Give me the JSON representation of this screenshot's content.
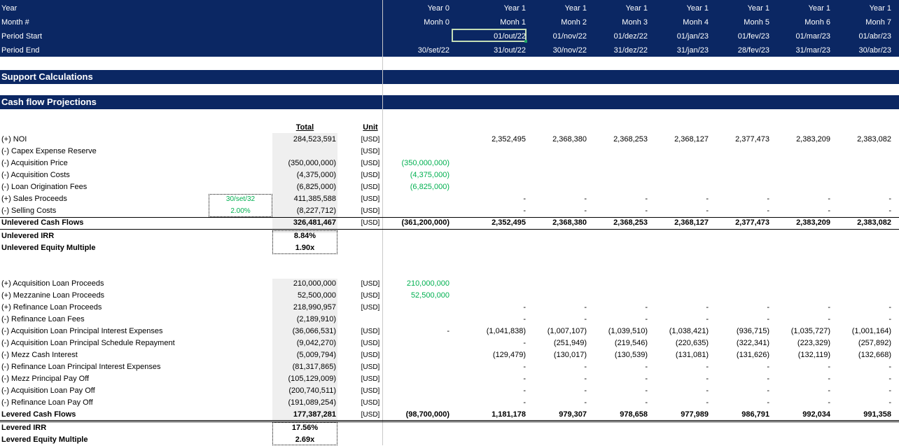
{
  "header": {
    "labels": [
      "Year",
      "Month #",
      "Period Start",
      "Period End"
    ],
    "columns": [
      {
        "year": "Year 0",
        "month": "Monh 0",
        "start": "",
        "end": "30/set/22"
      },
      {
        "year": "Year 1",
        "month": "Monh 1",
        "start": "01/out/22",
        "end": "31/out/22"
      },
      {
        "year": "Year 1",
        "month": "Monh 2",
        "start": "01/nov/22",
        "end": "30/nov/22"
      },
      {
        "year": "Year 1",
        "month": "Monh 3",
        "start": "01/dez/22",
        "end": "31/dez/22"
      },
      {
        "year": "Year 1",
        "month": "Monh 4",
        "start": "01/jan/23",
        "end": "31/jan/23"
      },
      {
        "year": "Year 1",
        "month": "Monh 5",
        "start": "01/fev/23",
        "end": "28/fev/23"
      },
      {
        "year": "Year 1",
        "month": "Monh 6",
        "start": "01/mar/23",
        "end": "31/mar/23"
      },
      {
        "year": "Year 1",
        "month": "Monh 7",
        "start": "01/abr/23",
        "end": "30/abr/23"
      }
    ]
  },
  "sections": {
    "support": "Support Calculations",
    "cashflow": "Cash flow Projections"
  },
  "table_header": {
    "total": "Total",
    "unit": "Unit"
  },
  "inputs": {
    "sale_date": "30/set/32",
    "selling_cost_pct": "2.00%"
  },
  "unlevered_rows": [
    {
      "label": "(+) NOI",
      "total": "284,523,591",
      "unit": "[USD]",
      "m0": "",
      "m0_green": false,
      "months": [
        "2,352,495",
        "2,368,380",
        "2,368,253",
        "2,368,127",
        "2,377,473",
        "2,383,209",
        "2,383,082"
      ]
    },
    {
      "label": "(-) Capex Expense Reserve",
      "total": "",
      "unit": "[USD]",
      "m0": "",
      "m0_green": false,
      "months": [
        "",
        "",
        "",
        "",
        "",
        "",
        ""
      ]
    },
    {
      "label": "(-) Acquisition Price",
      "total": "(350,000,000)",
      "unit": "[USD]",
      "m0": "(350,000,000)",
      "m0_green": true,
      "months": [
        "",
        "",
        "",
        "",
        "",
        "",
        ""
      ]
    },
    {
      "label": "(-) Acquisition Costs",
      "total": "(4,375,000)",
      "unit": "[USD]",
      "m0": "(4,375,000)",
      "m0_green": true,
      "months": [
        "",
        "",
        "",
        "",
        "",
        "",
        ""
      ]
    },
    {
      "label": "(-) Loan Origination Fees",
      "total": "(6,825,000)",
      "unit": "[USD]",
      "m0": "(6,825,000)",
      "m0_green": true,
      "months": [
        "",
        "",
        "",
        "",
        "",
        "",
        ""
      ]
    },
    {
      "label": "(+) Sales Proceeds",
      "total": "411,385,588",
      "unit": "[USD]",
      "m0": "",
      "m0_green": false,
      "months": [
        "-",
        "-",
        "-",
        "-",
        "-",
        "-",
        "-"
      ]
    },
    {
      "label": "(-) Selling Costs",
      "total": "(8,227,712)",
      "unit": "[USD]",
      "m0": "",
      "m0_green": false,
      "months": [
        "-",
        "-",
        "-",
        "-",
        "-",
        "-",
        "-"
      ]
    }
  ],
  "unlevered_total": {
    "label": "Unlevered Cash Flows",
    "total": "326,481,467",
    "unit": "[USD]",
    "m0": "(361,200,000)",
    "months": [
      "2,352,495",
      "2,368,380",
      "2,368,253",
      "2,368,127",
      "2,377,473",
      "2,383,209",
      "2,383,082"
    ]
  },
  "unlevered_metrics": [
    {
      "label": "Unlevered IRR",
      "value": "8.84%"
    },
    {
      "label": "Unlevered Equity Multiple",
      "value": "1.90x"
    }
  ],
  "levered_rows": [
    {
      "label": "(+) Acquisition Loan Proceeds",
      "total": "210,000,000",
      "unit": "[USD]",
      "m0": "210,000,000",
      "m0_green": true,
      "months": [
        "",
        "",
        "",
        "",
        "",
        "",
        ""
      ]
    },
    {
      "label": "(+) Mezzanine Loan Proceeds",
      "total": "52,500,000",
      "unit": "[USD]",
      "m0": "52,500,000",
      "m0_green": true,
      "months": [
        "",
        "",
        "",
        "",
        "",
        "",
        ""
      ]
    },
    {
      "label": "(+) Refinance Loan Proceeds",
      "total": "218,990,957",
      "unit": "[USD]",
      "m0": "",
      "m0_green": false,
      "months": [
        "-",
        "-",
        "-",
        "-",
        "-",
        "-",
        "-"
      ]
    },
    {
      "label": "(-) Refinance Loan Fees",
      "total": "(2,189,910)",
      "unit": "",
      "m0": "",
      "m0_green": false,
      "months": [
        "-",
        "-",
        "-",
        "-",
        "-",
        "-",
        "-"
      ]
    },
    {
      "label": "(-) Acquisition Loan Principal Interest Expenses",
      "total": "(36,066,531)",
      "unit": "[USD]",
      "m0": "-",
      "m0_green": false,
      "months": [
        "(1,041,838)",
        "(1,007,107)",
        "(1,039,510)",
        "(1,038,421)",
        "(936,715)",
        "(1,035,727)",
        "(1,001,164)"
      ]
    },
    {
      "label": "(-) Acquisition Loan Principal Schedule Repayment",
      "total": "(9,042,270)",
      "unit": "[USD]",
      "m0": "",
      "m0_green": false,
      "months": [
        "-",
        "(251,949)",
        "(219,546)",
        "(220,635)",
        "(322,341)",
        "(223,329)",
        "(257,892)"
      ]
    },
    {
      "label": "(-) Mezz Cash Interest",
      "total": "(5,009,794)",
      "unit": "[USD]",
      "m0": "",
      "m0_green": false,
      "months": [
        "(129,479)",
        "(130,017)",
        "(130,539)",
        "(131,081)",
        "(131,626)",
        "(132,119)",
        "(132,668)"
      ]
    },
    {
      "label": "(-) Refinance Loan Principal Interest Expenses",
      "total": "(81,317,865)",
      "unit": "[USD]",
      "m0": "",
      "m0_green": false,
      "months": [
        "-",
        "-",
        "-",
        "-",
        "-",
        "-",
        "-"
      ]
    },
    {
      "label": "(-) Mezz Principal Pay Off",
      "total": "(105,129,009)",
      "unit": "[USD]",
      "m0": "",
      "m0_green": false,
      "months": [
        "-",
        "-",
        "-",
        "-",
        "-",
        "-",
        "-"
      ]
    },
    {
      "label": "(-) Acquisition Loan Pay Off",
      "total": "(200,740,511)",
      "unit": "[USD]",
      "m0": "",
      "m0_green": false,
      "months": [
        "-",
        "-",
        "-",
        "-",
        "-",
        "-",
        "-"
      ]
    },
    {
      "label": "(-) Refinance Loan Pay Off",
      "total": "(191,089,254)",
      "unit": "[USD]",
      "m0": "",
      "m0_green": false,
      "months": [
        "-",
        "-",
        "-",
        "-",
        "-",
        "-",
        "-"
      ]
    }
  ],
  "levered_total": {
    "label": "Levered Cash Flows",
    "total": "177,387,281",
    "unit": "[USD]",
    "m0": "(98,700,000)",
    "months": [
      "1,181,178",
      "979,307",
      "978,658",
      "977,989",
      "986,791",
      "992,034",
      "991,358"
    ]
  },
  "levered_metrics": [
    {
      "label": "Levered IRR",
      "value": "17.56%"
    },
    {
      "label": "Levered Equity Multiple",
      "value": "2.69x"
    }
  ]
}
